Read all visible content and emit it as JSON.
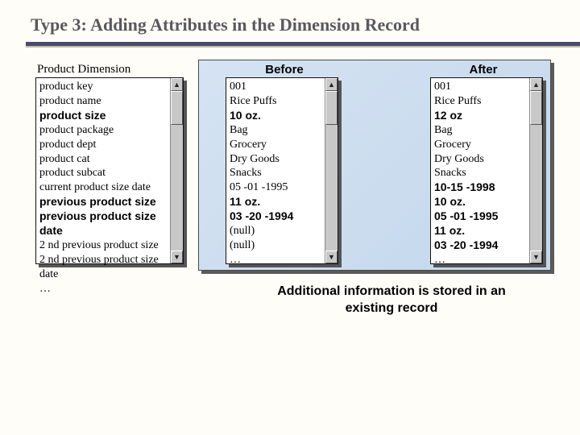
{
  "title": "Type 3: Adding Attributes in the Dimension Record",
  "dimension_label": "Product Dimension",
  "columns": {
    "before": "Before",
    "after": "After"
  },
  "attributes": [
    {
      "text": "product key",
      "bold": false
    },
    {
      "text": "product name",
      "bold": false
    },
    {
      "text": "product size",
      "bold": true
    },
    {
      "text": "product package",
      "bold": false
    },
    {
      "text": "product dept",
      "bold": false
    },
    {
      "text": "product cat",
      "bold": false
    },
    {
      "text": "product subcat",
      "bold": false
    },
    {
      "text": "current product size date",
      "bold": false
    },
    {
      "text": "previous product size",
      "bold": true
    },
    {
      "text": "previous product size date",
      "bold": true
    },
    {
      "text": "2 nd previous product size",
      "bold": false
    },
    {
      "text": "2 nd previous product size date",
      "bold": false
    },
    {
      "text": "…",
      "bold": false
    }
  ],
  "before": [
    {
      "text": "001",
      "bold": false
    },
    {
      "text": "Rice Puffs",
      "bold": false
    },
    {
      "text": "10 oz.",
      "bold": true
    },
    {
      "text": "Bag",
      "bold": false
    },
    {
      "text": "Grocery",
      "bold": false
    },
    {
      "text": "Dry Goods",
      "bold": false
    },
    {
      "text": "Snacks",
      "bold": false
    },
    {
      "text": "05 -01 -1995",
      "bold": false
    },
    {
      "text": "11 oz.",
      "bold": true
    },
    {
      "text": "03 -20 -1994",
      "bold": true
    },
    {
      "text": "(null)",
      "bold": false
    },
    {
      "text": "(null)",
      "bold": false
    },
    {
      "text": "…",
      "bold": false
    }
  ],
  "after": [
    {
      "text": "001",
      "bold": false
    },
    {
      "text": "Rice Puffs",
      "bold": false
    },
    {
      "text": "12 oz",
      "bold": true
    },
    {
      "text": "Bag",
      "bold": false
    },
    {
      "text": "Grocery",
      "bold": false
    },
    {
      "text": "Dry Goods",
      "bold": false
    },
    {
      "text": "Snacks",
      "bold": false
    },
    {
      "text": "10-15 -1998",
      "bold": true
    },
    {
      "text": "10 oz.",
      "bold": true
    },
    {
      "text": "05 -01 -1995",
      "bold": true
    },
    {
      "text": "11 oz.",
      "bold": true
    },
    {
      "text": "03 -20 -1994",
      "bold": true
    },
    {
      "text": "…",
      "bold": false
    }
  ],
  "caption": "Additional information is stored in an existing record"
}
